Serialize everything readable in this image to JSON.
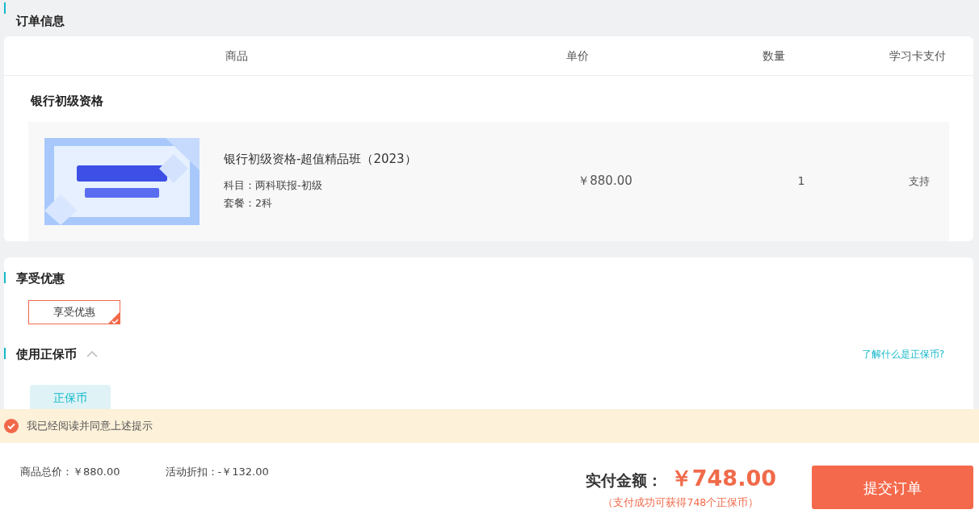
{
  "order_section": {
    "title": "订单信息",
    "table": {
      "columns": [
        "商品",
        "单价",
        "数量",
        "学习卡支付"
      ],
      "groups": [
        {
          "name": "银行初级资格",
          "items": [
            {
              "title": "银行初级资格-超值精品班（2023）",
              "details": [
                "科目：两科联报-初级",
                "套餐：2科"
              ],
              "price": "￥880.00",
              "quantity": "1",
              "card_payment": "支持"
            }
          ]
        }
      ]
    }
  },
  "discount_section": {
    "title": "享受优惠",
    "options": [
      {
        "label": "享受优惠",
        "selected": true
      }
    ]
  },
  "coin_section": {
    "title": "使用正保币",
    "expanded": true,
    "help_link": "了解什么是正保币?",
    "tabs": [
      {
        "label": "正保币",
        "selected": true
      }
    ]
  },
  "agreement": {
    "label": "我已经阅读并同意上述提示",
    "checked": true
  },
  "footer": {
    "subtotal": "商品总价：￥880.00",
    "discount": "活动折扣：-￥132.00",
    "total_label": "实付金额：",
    "total": "￥748.00",
    "reward_note": "（支付成功可获得748个正保币）",
    "submit": "提交订单"
  }
}
